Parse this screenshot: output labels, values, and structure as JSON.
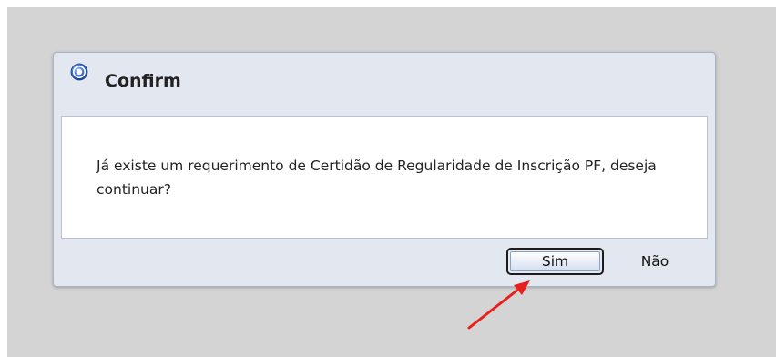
{
  "dialog": {
    "title": "Confirm",
    "icon": "question-icon",
    "message": "Já existe um requerimento de Certidão de Regularidade de Inscrição PF, deseja continuar?",
    "buttons": {
      "yes_label": "Sim",
      "no_label": "Não"
    }
  },
  "annotation": {
    "icon": "arrow-icon",
    "color": "#e8201b"
  },
  "colors": {
    "backdrop": "#d4d4d4",
    "dialog_background": "#e3e7f0",
    "dialog_border": "#a7b3c7",
    "icon_blue": "#3b6fc9"
  }
}
